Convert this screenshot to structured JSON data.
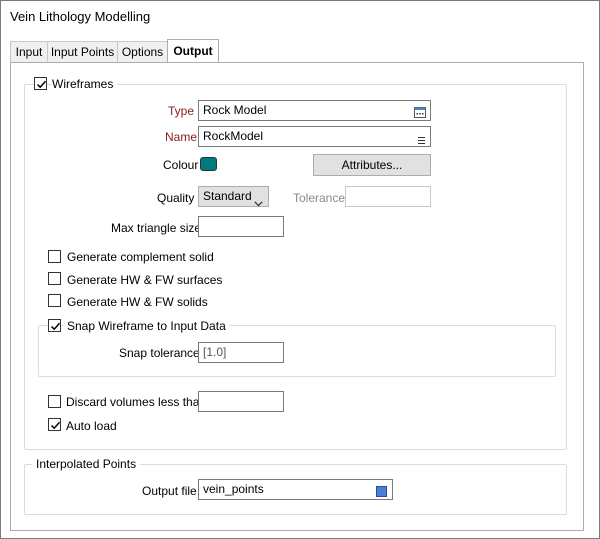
{
  "window": {
    "title": "Vein Lithology Modelling"
  },
  "tabs": [
    {
      "label": "Input"
    },
    {
      "label": "Input Points"
    },
    {
      "label": "Options"
    },
    {
      "label": "Output",
      "active": true
    }
  ],
  "wireframes": {
    "label": "Wireframes",
    "checked": true,
    "type_label": "Type",
    "type_value": "Rock Model",
    "name_label": "Name",
    "name_value": "RockModel",
    "colour_label": "Colour",
    "colour_value": "#007b7b",
    "attributes_button": "Attributes...",
    "quality_label": "Quality",
    "quality_value": "Standard",
    "tolerance_label": "Tolerance",
    "tolerance_value": "",
    "max_triangle_label": "Max triangle size",
    "max_triangle_value": "",
    "generate_complement": {
      "label": "Generate complement solid",
      "checked": false
    },
    "generate_surfaces": {
      "label": "Generate HW & FW surfaces",
      "checked": false
    },
    "generate_solids": {
      "label": "Generate HW & FW solids",
      "checked": false
    },
    "snap": {
      "label": "Snap Wireframe to Input Data",
      "checked": true,
      "tolerance_label": "Snap tolerance",
      "tolerance_value": "[1.0]"
    },
    "discard": {
      "label": "Discard volumes less than",
      "checked": false,
      "value": ""
    },
    "auto_load": {
      "label": "Auto load",
      "checked": true
    }
  },
  "interpolated": {
    "legend": "Interpolated Points",
    "output_label": "Output file",
    "output_value": "vein_points"
  },
  "colors": {
    "required_label": "#8b1a1a",
    "file_icon": "#4a7fd6"
  }
}
